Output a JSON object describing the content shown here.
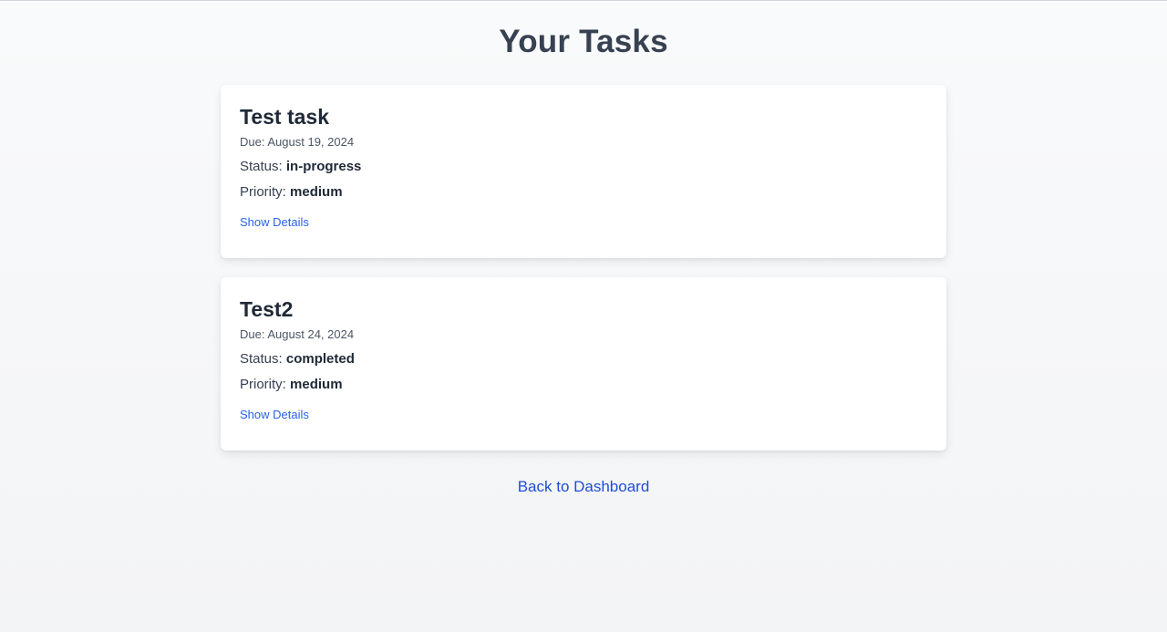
{
  "page": {
    "title": "Your Tasks",
    "back_link": "Back to Dashboard"
  },
  "labels": {
    "due_prefix": "Due:",
    "status_prefix": "Status:",
    "priority_prefix": "Priority:",
    "show_details": "Show Details"
  },
  "tasks": [
    {
      "title": "Test task",
      "due": "August 19, 2024",
      "status": "in-progress",
      "priority": "medium"
    },
    {
      "title": "Test2",
      "due": "August 24, 2024",
      "status": "completed",
      "priority": "medium"
    }
  ],
  "colors": {
    "link": "#2563eb",
    "title": "#374151",
    "card_bg": "#ffffff"
  }
}
